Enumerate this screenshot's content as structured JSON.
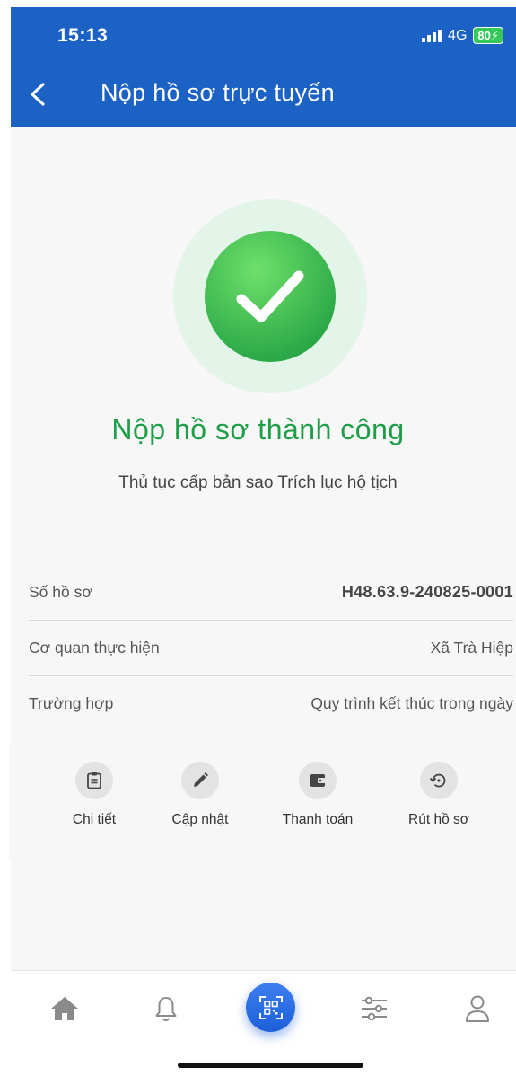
{
  "status_bar": {
    "time": "15:13",
    "network": "4G",
    "battery": "80"
  },
  "header": {
    "title": "Nộp hồ sơ trực tuyến"
  },
  "success": {
    "title": "Nộp hồ sơ thành công",
    "subtitle": "Thủ tục cấp bản sao Trích lục hộ tịch"
  },
  "details": [
    {
      "label": "Số hồ sơ",
      "value": "H48.63.9-240825-0001"
    },
    {
      "label": "Cơ quan thực hiện",
      "value": "Xã Trà Hiệp"
    },
    {
      "label": "Trường hợp",
      "value": "Quy trình kết thúc trong ngày"
    }
  ],
  "actions": [
    {
      "label": "Chi tiết",
      "icon": "clipboard-icon"
    },
    {
      "label": "Cập nhật",
      "icon": "pencil-icon"
    },
    {
      "label": "Thanh toán",
      "icon": "wallet-icon"
    },
    {
      "label": "Rút hồ sơ",
      "icon": "history-icon"
    }
  ],
  "bottom_nav": [
    "home-icon",
    "bell-icon",
    "qr-scan-icon",
    "sliders-icon",
    "user-icon"
  ],
  "colors": {
    "header": "#1b62c4",
    "success_green": "#1e9e47",
    "qr_button": "#1c5fd8"
  }
}
